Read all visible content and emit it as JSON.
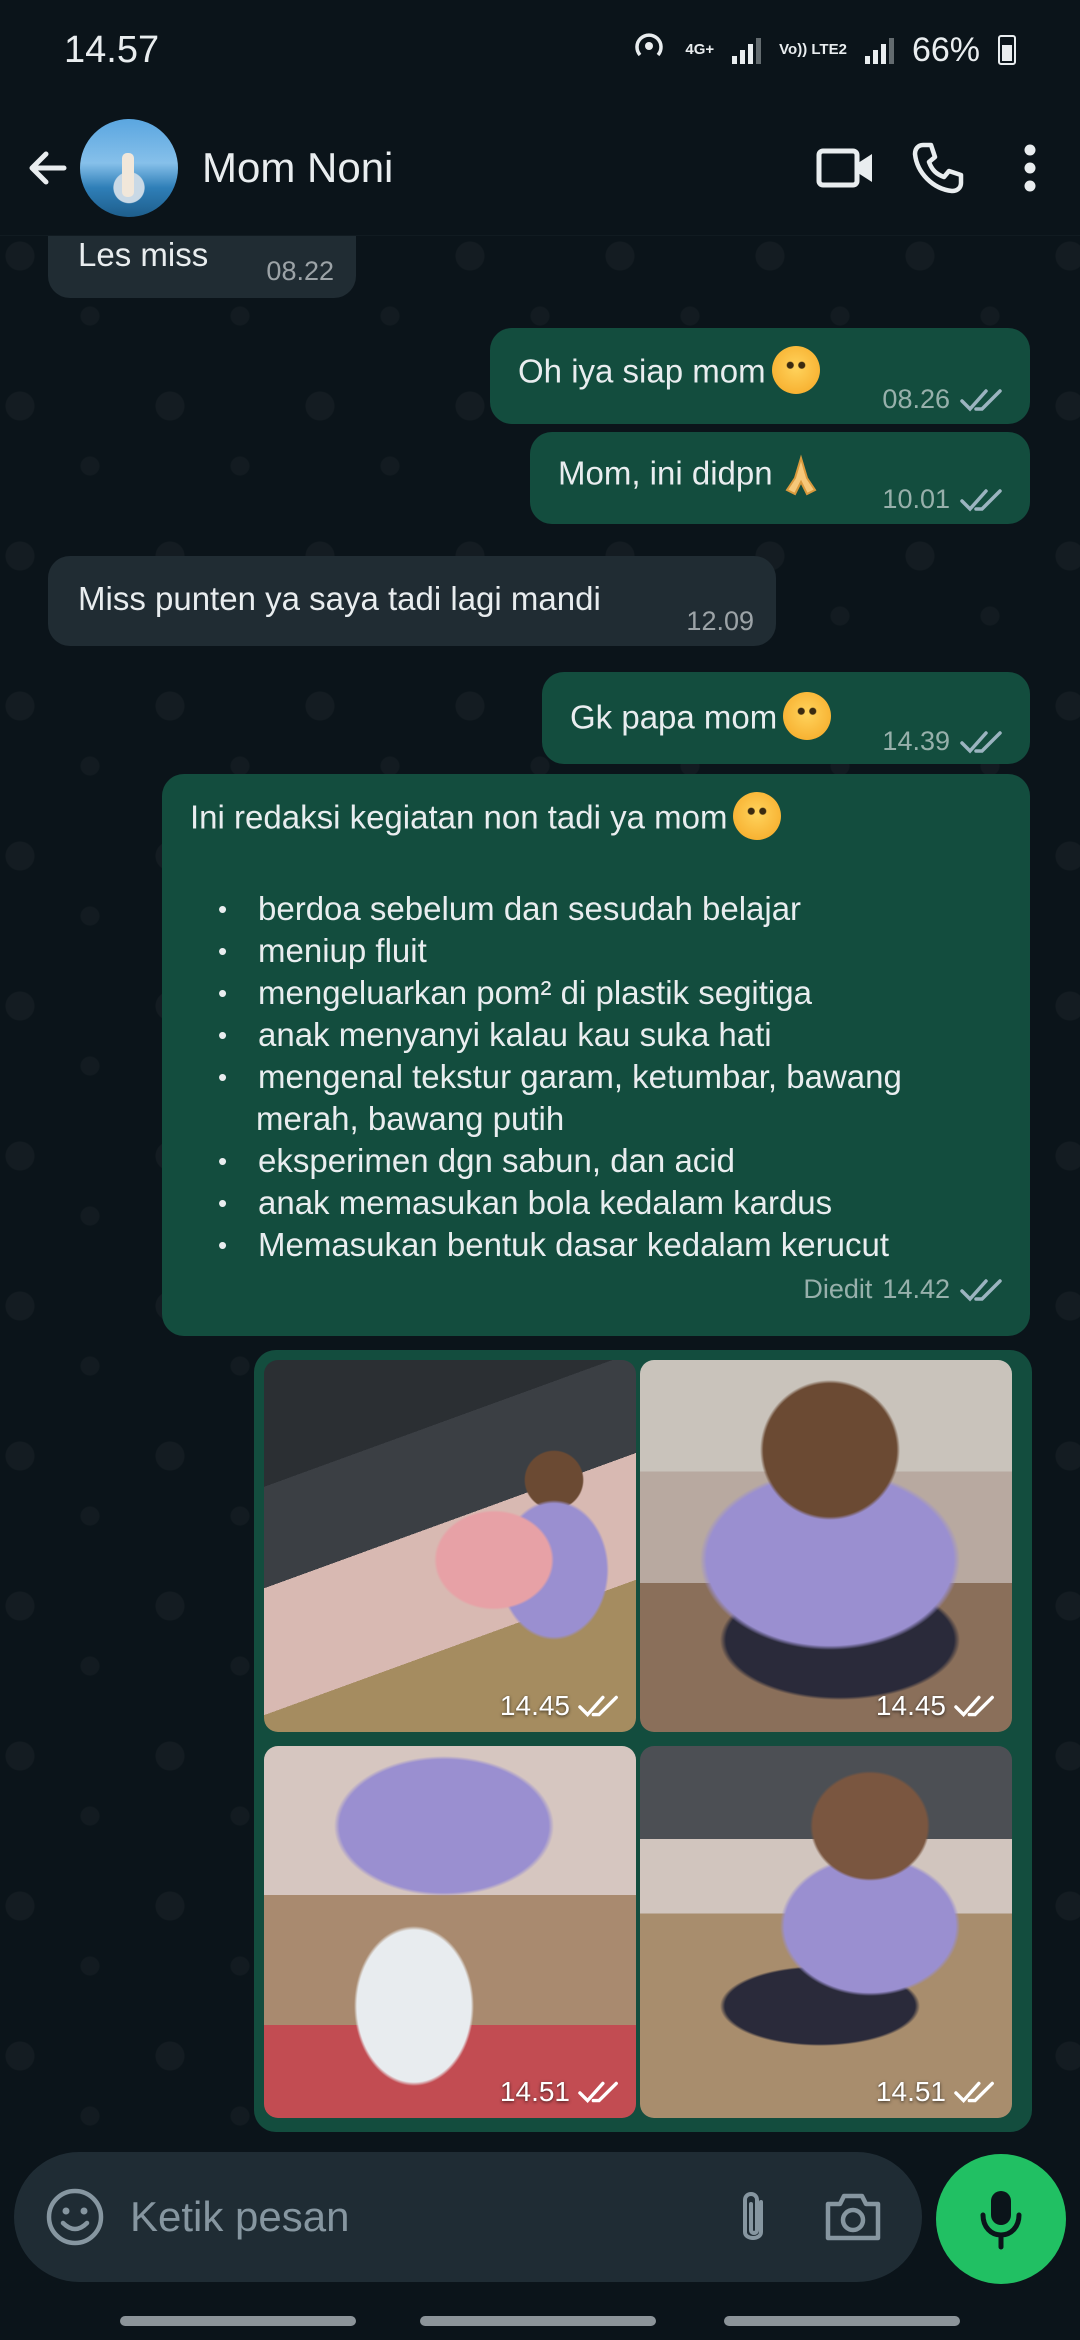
{
  "status_bar": {
    "time": "14.57",
    "net_top": "4G+",
    "net_bottom": "Vo)) LTE2",
    "battery": "66%"
  },
  "header": {
    "contact_name": "Mom Noni",
    "icons": [
      "back-arrow-icon",
      "video-call-icon",
      "voice-call-icon",
      "more-options-icon"
    ]
  },
  "messages": [
    {
      "dir": "in",
      "text": "Les miss",
      "time": "08.22"
    },
    {
      "dir": "out",
      "text": "Oh iya siap  mom",
      "emoji": "hugging-face",
      "time": "08.26",
      "read": true
    },
    {
      "dir": "out",
      "text": "Mom, ini didpn",
      "emoji": "folded-hands",
      "time": "10.01",
      "read": true
    },
    {
      "dir": "in",
      "text": "Miss punten ya saya tadi lagi mandi",
      "time": "12.09"
    },
    {
      "dir": "out",
      "text": "Gk papa mom",
      "emoji": "hugging-face",
      "time": "14.39",
      "read": true
    },
    {
      "dir": "out",
      "text": "Ini redaksi kegiatan non tadi ya mom",
      "emoji": "hugging-face",
      "list": [
        "berdoa sebelum dan sesudah belajar",
        "meniup fluit",
        "mengeluarkan pom² di plastik segitiga",
        "anak menyanyi kalau kau suka hati",
        "mengenal tekstur garam, ketumbar, bawang",
        "merah, bawang putih",
        "eksperimen dgn sabun, dan acid",
        "anak memasukan bola kedalam kardus",
        "Memasukan bentuk dasar kedalam kerucut"
      ],
      "edited_label": "Diedit",
      "time": "14.42",
      "read": true
    }
  ],
  "media": [
    {
      "time": "14.45",
      "read": true
    },
    {
      "time": "14.45",
      "read": true
    },
    {
      "time": "14.51",
      "read": true
    },
    {
      "time": "14.51",
      "read": true
    }
  ],
  "input": {
    "placeholder": "Ketik pesan",
    "icons": [
      "emoji-icon",
      "attach-icon",
      "camera-icon",
      "mic-icon"
    ]
  },
  "colors": {
    "background": "#0b141a",
    "incoming": "#202c33",
    "outgoing": "#134d3e",
    "accent": "#21c063",
    "tick_read": "#9bb4c0"
  }
}
